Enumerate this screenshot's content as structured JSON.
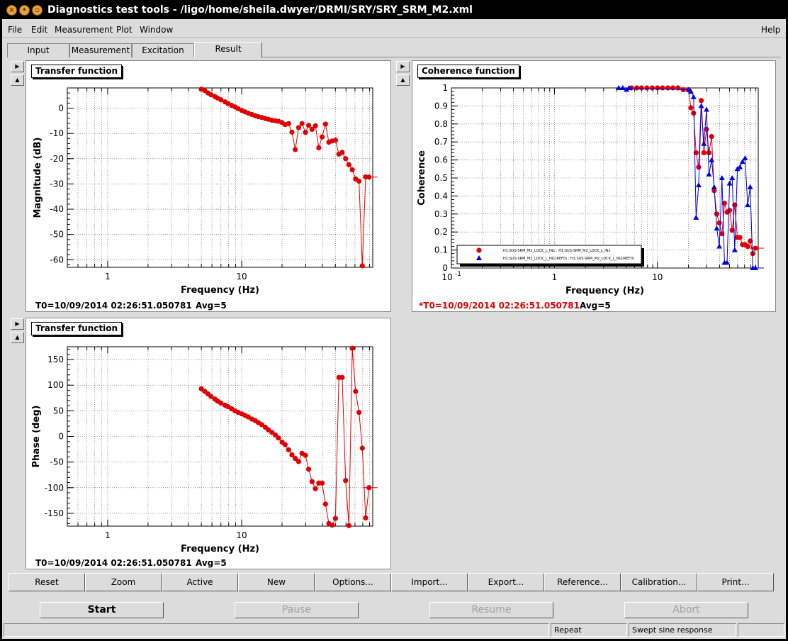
{
  "window": {
    "title": "Diagnostics test tools - /ligo/home/sheila.dwyer/DRMI/SRY/SRY_SRM_M2.xml"
  },
  "menu": {
    "file": "File",
    "edit": "Edit",
    "measurement": "Measurement",
    "plot": "Plot",
    "window": "Window",
    "help": "Help"
  },
  "tabs": [
    "Input",
    "Measurement",
    "Excitation",
    "Result"
  ],
  "active_tab": "Result",
  "panels": {
    "magnitude": {
      "title": "Transfer function",
      "footer_t0": "T0=10/09/2014 02:26:51.050781",
      "footer_avg": "Avg=5"
    },
    "coherence": {
      "title": "Coherence function",
      "footer_t0": "*T0=10/09/2014 02:26:51.050781",
      "footer_avg": "Avg=5"
    },
    "phase": {
      "title": "Transfer function",
      "footer_t0": "T0=10/09/2014 02:26:51.050781",
      "footer_avg": "Avg=5"
    }
  },
  "chart_data": [
    {
      "type": "line",
      "title": "Transfer function",
      "xlabel": "Frequency (Hz)",
      "ylabel": "Magnitude (dB)",
      "xscale": "log",
      "xlim": [
        0.5,
        95
      ],
      "ylim": [
        -63,
        8
      ],
      "xticks": [
        "1",
        "10"
      ],
      "yticks": [
        "0",
        "-10",
        "-20",
        "-30",
        "-40",
        "-50",
        "-60"
      ],
      "grid": true,
      "color": "#e00000",
      "series": [
        {
          "x": [
            5.0,
            5.3,
            5.6,
            5.9,
            6.3,
            6.6,
            7.0,
            7.5,
            7.9,
            8.4,
            8.9,
            9.4,
            10.0,
            10.6,
            11.2,
            11.9,
            12.6,
            13.3,
            14.1,
            15.0,
            15.8,
            16.8,
            17.8,
            18.8,
            20.0,
            21.1,
            22.4,
            23.7,
            25.1,
            26.6,
            28.2,
            29.9,
            31.6,
            33.5,
            35.5,
            37.6,
            39.8,
            42.2,
            44.7,
            47.3,
            50.1,
            53.1,
            56.2,
            59.6,
            63.1,
            66.8,
            70.8,
            75.0,
            79.4,
            84.1,
            89.1
          ],
          "y": [
            7.5,
            7.0,
            6.0,
            5.3,
            4.6,
            4.0,
            3.3,
            2.5,
            1.8,
            1.1,
            0.5,
            -0.2,
            -0.9,
            -1.5,
            -2.0,
            -2.5,
            -3.0,
            -3.4,
            -3.7,
            -4.1,
            -4.4,
            -4.8,
            -5.0,
            -5.2,
            -5.7,
            -6.5,
            -6.1,
            -9.5,
            -16.4,
            -7.7,
            -6.1,
            -9.6,
            -6.8,
            -8.4,
            -7.0,
            -15.7,
            -11.4,
            -6.3,
            -13.5,
            -13.0,
            -12.7,
            -18.2,
            -17.5,
            -20.0,
            -22.4,
            -24.4,
            -28.0,
            -28.9,
            -62.4,
            -27.2,
            -27.3
          ]
        }
      ]
    },
    {
      "type": "line",
      "title": "Coherence function",
      "xlabel": "Frequency (Hz)",
      "ylabel": "Coherence",
      "xscale": "log",
      "xlim": [
        0.1,
        95
      ],
      "ylim": [
        0,
        1
      ],
      "xticks": [
        "10^-1",
        "1",
        "10"
      ],
      "yticks": [
        "0",
        "0.1",
        "0.2",
        "0.3",
        "0.4",
        "0.5",
        "0.6",
        "0.7",
        "0.8",
        "0.9",
        "1"
      ],
      "grid": true,
      "legend_position": "bottom-left",
      "series": [
        {
          "name": "H1:SUS-SRM_M2_LOCK_L_IN1 : H1:SUS-SRM_M2_LOCK_L_IN2",
          "color": "#e00000",
          "marker": "circle",
          "x": [
            5.6,
            6.3,
            7.0,
            7.9,
            8.9,
            10.0,
            11.2,
            12.6,
            14.1,
            15.8,
            17.8,
            20.0,
            21.1,
            22.4,
            23.7,
            25.1,
            26.6,
            28.2,
            29.9,
            31.6,
            33.5,
            35.5,
            37.6,
            39.8,
            42.2,
            44.7,
            47.3,
            50.1,
            53.1,
            56.2,
            59.6,
            63.1,
            66.8,
            70.8,
            75.0,
            79.4,
            84.1,
            89.1
          ],
          "y": [
            1.0,
            1.0,
            1.0,
            1.0,
            1.0,
            1.0,
            1.0,
            1.0,
            1.0,
            1.0,
            0.99,
            0.99,
            0.89,
            0.86,
            0.64,
            0.56,
            0.93,
            0.64,
            0.77,
            0.64,
            0.73,
            0.43,
            0.3,
            0.25,
            0.19,
            0.36,
            0.31,
            0.32,
            0.21,
            0.35,
            0.17,
            0.17,
            0.13,
            0.13,
            0.12,
            0.15,
            0.08,
            0.11
          ]
        },
        {
          "name": "H1:SUS-SRM_M2_LOCK_L_IN1(REF0) : H1:SUS-SRM_M2_LOCK_L_IN2(REF0)",
          "color": "#0000e0",
          "marker": "triangle",
          "x": [
            4.2,
            4.6,
            5.0,
            5.3,
            20.0,
            21.1,
            22.4,
            23.7,
            25.1,
            26.6,
            28.2,
            29.9,
            31.6,
            33.5,
            35.5,
            37.6,
            39.8,
            42.2,
            44.7,
            47.3,
            50.1,
            53.1,
            56.2,
            59.6,
            63.1,
            66.8,
            70.8,
            75.0,
            79.4,
            84.1,
            89.1
          ],
          "y": [
            1.0,
            1.0,
            0.99,
            1.0,
            0.99,
            0.98,
            0.95,
            0.28,
            0.46,
            0.9,
            0.69,
            0.88,
            0.52,
            0.6,
            0.45,
            0.22,
            0.12,
            0.5,
            0.03,
            0.03,
            0.47,
            0.5,
            0.1,
            0.55,
            0.56,
            0.59,
            0.61,
            0.35,
            0.45,
            0.0,
            0.0
          ]
        }
      ]
    },
    {
      "type": "line",
      "title": "Transfer function",
      "xlabel": "Frequency (Hz)",
      "ylabel": "Phase (deg)",
      "xscale": "log",
      "xlim": [
        0.5,
        95
      ],
      "ylim": [
        -175,
        175
      ],
      "xticks": [
        "1",
        "10"
      ],
      "yticks": [
        "150",
        "100",
        "50",
        "0",
        "-50",
        "-100",
        "-150"
      ],
      "grid": true,
      "color": "#e00000",
      "series": [
        {
          "x": [
            5.0,
            5.3,
            5.6,
            5.9,
            6.3,
            6.6,
            7.0,
            7.5,
            7.9,
            8.4,
            8.9,
            9.4,
            10.0,
            10.6,
            11.2,
            11.9,
            12.6,
            13.3,
            14.1,
            15.0,
            15.8,
            16.8,
            17.8,
            18.8,
            20.0,
            21.1,
            22.4,
            23.7,
            25.1,
            26.6,
            28.2,
            29.9,
            31.6,
            33.5,
            35.5,
            37.6,
            39.8,
            42.2,
            44.7,
            47.3,
            50.1,
            53.1,
            56.2,
            59.6,
            63.1,
            66.8,
            70.8,
            75.0,
            79.4,
            84.1,
            89.1
          ],
          "y": [
            93,
            88,
            83,
            78,
            73,
            69,
            65,
            61,
            58,
            54,
            50,
            47,
            44,
            41,
            38,
            34,
            31,
            27,
            23,
            18,
            13,
            8,
            3,
            -3,
            -11,
            -16,
            -26,
            -36,
            -43,
            -49,
            -33,
            -37,
            -64,
            -88,
            -102,
            -91,
            -91,
            -132,
            -170,
            -173,
            -160,
            115,
            115,
            -86,
            -174,
            172,
            88,
            47,
            -23,
            -159,
            -100
          ]
        }
      ]
    }
  ],
  "toolbar": [
    "Reset",
    "Zoom",
    "Active",
    "New",
    "Options...",
    "Import...",
    "Export...",
    "Reference...",
    "Calibration...",
    "Print..."
  ],
  "actions": {
    "start": "Start",
    "pause": "Pause",
    "resume": "Resume",
    "abort": "Abort"
  },
  "status": {
    "mode": "Repeat",
    "type": "Swept sine response"
  }
}
